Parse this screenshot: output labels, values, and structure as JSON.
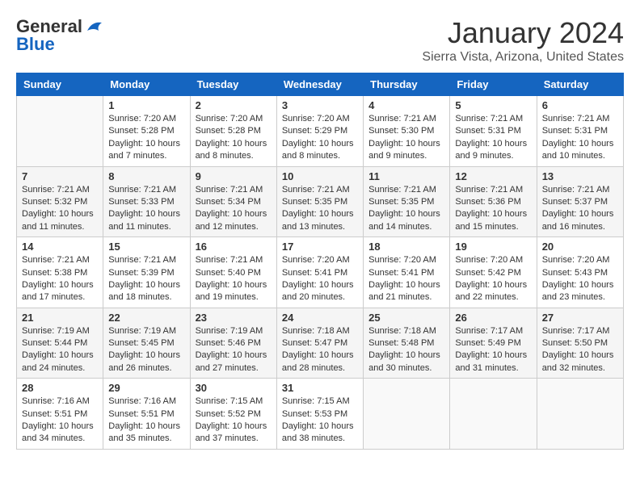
{
  "header": {
    "logo_general": "General",
    "logo_blue": "Blue",
    "title": "January 2024",
    "subtitle": "Sierra Vista, Arizona, United States"
  },
  "days_of_week": [
    "Sunday",
    "Monday",
    "Tuesday",
    "Wednesday",
    "Thursday",
    "Friday",
    "Saturday"
  ],
  "weeks": [
    [
      {
        "day": "",
        "info": ""
      },
      {
        "day": "1",
        "info": "Sunrise: 7:20 AM\nSunset: 5:28 PM\nDaylight: 10 hours\nand 7 minutes."
      },
      {
        "day": "2",
        "info": "Sunrise: 7:20 AM\nSunset: 5:28 PM\nDaylight: 10 hours\nand 8 minutes."
      },
      {
        "day": "3",
        "info": "Sunrise: 7:20 AM\nSunset: 5:29 PM\nDaylight: 10 hours\nand 8 minutes."
      },
      {
        "day": "4",
        "info": "Sunrise: 7:21 AM\nSunset: 5:30 PM\nDaylight: 10 hours\nand 9 minutes."
      },
      {
        "day": "5",
        "info": "Sunrise: 7:21 AM\nSunset: 5:31 PM\nDaylight: 10 hours\nand 9 minutes."
      },
      {
        "day": "6",
        "info": "Sunrise: 7:21 AM\nSunset: 5:31 PM\nDaylight: 10 hours\nand 10 minutes."
      }
    ],
    [
      {
        "day": "7",
        "info": "Sunrise: 7:21 AM\nSunset: 5:32 PM\nDaylight: 10 hours\nand 11 minutes."
      },
      {
        "day": "8",
        "info": "Sunrise: 7:21 AM\nSunset: 5:33 PM\nDaylight: 10 hours\nand 11 minutes."
      },
      {
        "day": "9",
        "info": "Sunrise: 7:21 AM\nSunset: 5:34 PM\nDaylight: 10 hours\nand 12 minutes."
      },
      {
        "day": "10",
        "info": "Sunrise: 7:21 AM\nSunset: 5:35 PM\nDaylight: 10 hours\nand 13 minutes."
      },
      {
        "day": "11",
        "info": "Sunrise: 7:21 AM\nSunset: 5:35 PM\nDaylight: 10 hours\nand 14 minutes."
      },
      {
        "day": "12",
        "info": "Sunrise: 7:21 AM\nSunset: 5:36 PM\nDaylight: 10 hours\nand 15 minutes."
      },
      {
        "day": "13",
        "info": "Sunrise: 7:21 AM\nSunset: 5:37 PM\nDaylight: 10 hours\nand 16 minutes."
      }
    ],
    [
      {
        "day": "14",
        "info": "Sunrise: 7:21 AM\nSunset: 5:38 PM\nDaylight: 10 hours\nand 17 minutes."
      },
      {
        "day": "15",
        "info": "Sunrise: 7:21 AM\nSunset: 5:39 PM\nDaylight: 10 hours\nand 18 minutes."
      },
      {
        "day": "16",
        "info": "Sunrise: 7:21 AM\nSunset: 5:40 PM\nDaylight: 10 hours\nand 19 minutes."
      },
      {
        "day": "17",
        "info": "Sunrise: 7:20 AM\nSunset: 5:41 PM\nDaylight: 10 hours\nand 20 minutes."
      },
      {
        "day": "18",
        "info": "Sunrise: 7:20 AM\nSunset: 5:41 PM\nDaylight: 10 hours\nand 21 minutes."
      },
      {
        "day": "19",
        "info": "Sunrise: 7:20 AM\nSunset: 5:42 PM\nDaylight: 10 hours\nand 22 minutes."
      },
      {
        "day": "20",
        "info": "Sunrise: 7:20 AM\nSunset: 5:43 PM\nDaylight: 10 hours\nand 23 minutes."
      }
    ],
    [
      {
        "day": "21",
        "info": "Sunrise: 7:19 AM\nSunset: 5:44 PM\nDaylight: 10 hours\nand 24 minutes."
      },
      {
        "day": "22",
        "info": "Sunrise: 7:19 AM\nSunset: 5:45 PM\nDaylight: 10 hours\nand 26 minutes."
      },
      {
        "day": "23",
        "info": "Sunrise: 7:19 AM\nSunset: 5:46 PM\nDaylight: 10 hours\nand 27 minutes."
      },
      {
        "day": "24",
        "info": "Sunrise: 7:18 AM\nSunset: 5:47 PM\nDaylight: 10 hours\nand 28 minutes."
      },
      {
        "day": "25",
        "info": "Sunrise: 7:18 AM\nSunset: 5:48 PM\nDaylight: 10 hours\nand 30 minutes."
      },
      {
        "day": "26",
        "info": "Sunrise: 7:17 AM\nSunset: 5:49 PM\nDaylight: 10 hours\nand 31 minutes."
      },
      {
        "day": "27",
        "info": "Sunrise: 7:17 AM\nSunset: 5:50 PM\nDaylight: 10 hours\nand 32 minutes."
      }
    ],
    [
      {
        "day": "28",
        "info": "Sunrise: 7:16 AM\nSunset: 5:51 PM\nDaylight: 10 hours\nand 34 minutes."
      },
      {
        "day": "29",
        "info": "Sunrise: 7:16 AM\nSunset: 5:51 PM\nDaylight: 10 hours\nand 35 minutes."
      },
      {
        "day": "30",
        "info": "Sunrise: 7:15 AM\nSunset: 5:52 PM\nDaylight: 10 hours\nand 37 minutes."
      },
      {
        "day": "31",
        "info": "Sunrise: 7:15 AM\nSunset: 5:53 PM\nDaylight: 10 hours\nand 38 minutes."
      },
      {
        "day": "",
        "info": ""
      },
      {
        "day": "",
        "info": ""
      },
      {
        "day": "",
        "info": ""
      }
    ]
  ]
}
